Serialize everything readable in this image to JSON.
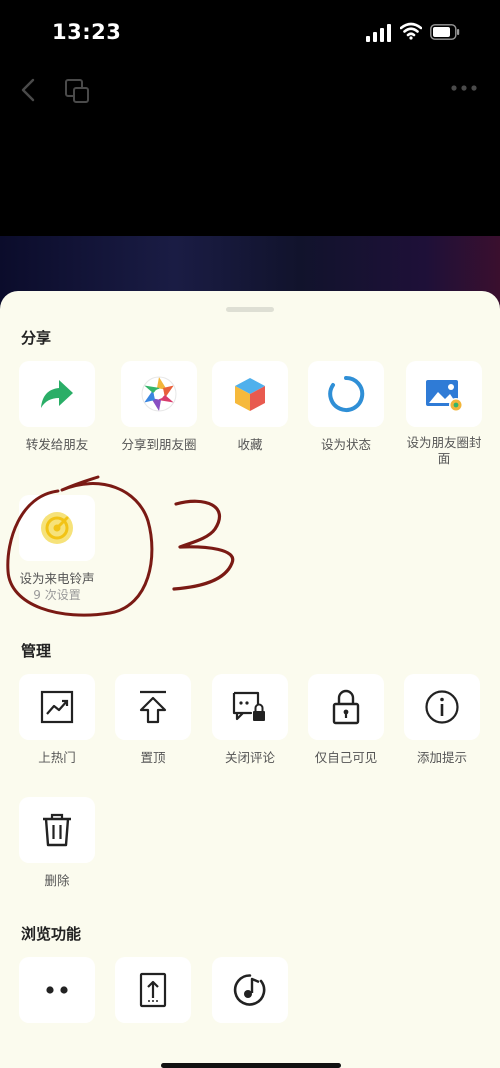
{
  "status_bar": {
    "time": "13:23"
  },
  "sections": {
    "share": {
      "title": "分享",
      "items": [
        {
          "label": "转发给朋友",
          "icon": "forward-arrow-icon"
        },
        {
          "label": "分享到朋友圈",
          "icon": "moments-aperture-icon"
        },
        {
          "label": "收藏",
          "icon": "favorite-cube-icon"
        },
        {
          "label": "设为状态",
          "icon": "status-ring-icon"
        },
        {
          "label": "设为朋友圈封面",
          "icon": "moments-cover-icon"
        },
        {
          "label": "设为来电铃声",
          "sub_label": "9 次设置",
          "icon": "ringtone-icon"
        }
      ]
    },
    "manage": {
      "title": "管理",
      "items": [
        {
          "label": "上热门",
          "icon": "trending-chart-icon"
        },
        {
          "label": "置顶",
          "icon": "pin-top-icon"
        },
        {
          "label": "关闭评论",
          "icon": "comment-lock-icon"
        },
        {
          "label": "仅自己可见",
          "icon": "padlock-icon"
        },
        {
          "label": "添加提示",
          "icon": "info-icon"
        },
        {
          "label": "删除",
          "icon": "trash-icon"
        }
      ]
    },
    "browse": {
      "title": "浏览功能",
      "items": [
        {
          "icon": "two-dots-icon"
        },
        {
          "icon": "upload-document-icon"
        },
        {
          "icon": "music-disc-icon"
        }
      ]
    }
  },
  "annotation": {
    "handwritten_text": "3"
  },
  "colors": {
    "sheet_bg": "#fbfbee",
    "share_green": "#2aae67",
    "scribble_red": "#7a1a14"
  }
}
